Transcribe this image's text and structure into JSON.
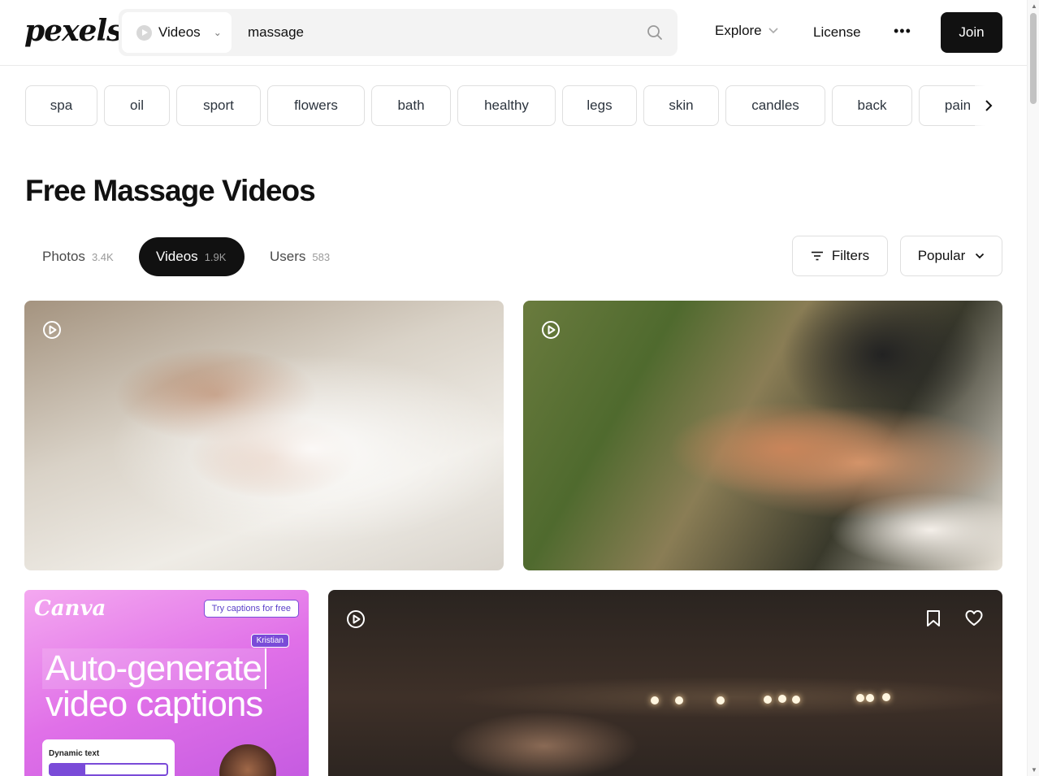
{
  "header": {
    "logo": "pexels",
    "search_type": "Videos",
    "search_value": "massage",
    "explore": "Explore",
    "license": "License",
    "more": "•••",
    "join": "Join"
  },
  "tags": [
    "spa",
    "oil",
    "sport",
    "flowers",
    "bath",
    "healthy",
    "legs",
    "skin",
    "candles",
    "back",
    "pain"
  ],
  "page_title": "Free Massage Videos",
  "tabs": [
    {
      "label": "Photos",
      "count": "3.4K"
    },
    {
      "label": "Videos",
      "count": "1.9K"
    },
    {
      "label": "Users",
      "count": "583"
    }
  ],
  "filters_label": "Filters",
  "sort_label": "Popular",
  "ad": {
    "brand": "Canva",
    "cta": "Try captions for free",
    "name_tag": "Kristian",
    "headline_1": "Auto-generate",
    "headline_2": "video captions",
    "card_label": "Dynamic text"
  },
  "icons": [
    "search-icon",
    "play-circle-icon",
    "chevron-down-icon",
    "chevron-right-icon",
    "filter-icon",
    "bookmark-icon",
    "heart-icon"
  ]
}
